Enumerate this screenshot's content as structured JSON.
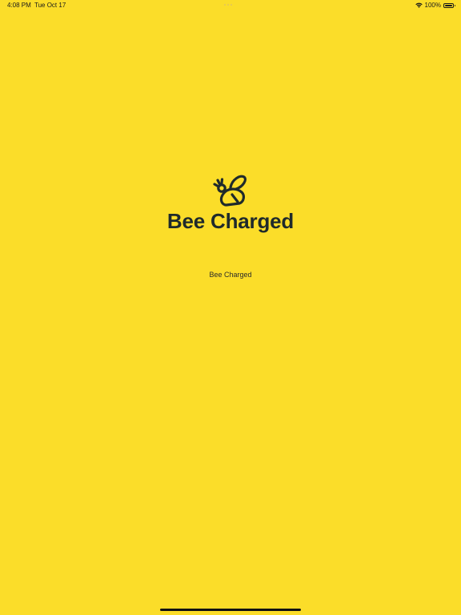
{
  "status_bar": {
    "time": "4:08 PM",
    "date": "Tue Oct 17",
    "battery_percent": "100%",
    "battery_level": 1.0,
    "icons": [
      "wifi-icon",
      "battery-icon"
    ]
  },
  "splash": {
    "brand_title": "Bee Charged",
    "subtitle": "Bee Charged",
    "logo_icon": "bee-icon"
  },
  "colors": {
    "background": "#FBDD29",
    "brand_text": "#1f2a2b"
  }
}
